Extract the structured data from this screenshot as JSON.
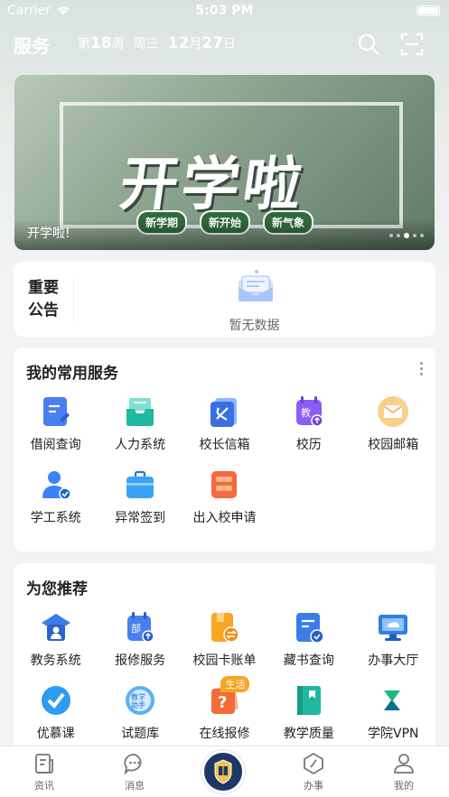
{
  "status_bar": {
    "carrier": "Carrier",
    "time": "5:03 PM"
  },
  "header": {
    "title": "服务",
    "week_prefix": "第",
    "week_num": "18",
    "week_suffix": "周",
    "weekday": "周三",
    "month": "12",
    "month_suffix": "月",
    "day": "27",
    "day_suffix": "日"
  },
  "banner": {
    "headline": "开学啦",
    "tags": [
      "新学期",
      "新开始",
      "新气象"
    ],
    "caption": "开学啦!",
    "page_count": 5,
    "active_page": 2
  },
  "notice": {
    "label": "重要公告",
    "empty_text": "暂无数据"
  },
  "services": {
    "title": "我的常用服务",
    "items": [
      {
        "label": "借阅查询",
        "icon": "borrow-icon",
        "color": "#4a7ff0"
      },
      {
        "label": "人力系统",
        "icon": "hr-inbox-icon",
        "color": "#1fb8a0"
      },
      {
        "label": "校长信箱",
        "icon": "principal-mailbox-icon",
        "color": "#3a6fe0"
      },
      {
        "label": "校历",
        "icon": "calendar-icon",
        "color": "#8b5cf6"
      },
      {
        "label": "校园邮箱",
        "icon": "email-icon",
        "color": "#f5b45a"
      },
      {
        "label": "学工系统",
        "icon": "user-check-icon",
        "color": "#3b82f6"
      },
      {
        "label": "异常签到",
        "icon": "briefcase-icon",
        "color": "#38a3f5"
      },
      {
        "label": "出入校申请",
        "icon": "gate-icon",
        "color": "#f26b3a"
      }
    ]
  },
  "recommend": {
    "title": "为您推荐",
    "items": [
      {
        "label": "教务系统",
        "icon": "academic-icon",
        "color": "#3b7de8"
      },
      {
        "label": "报修服务",
        "icon": "repair-icon",
        "color": "#4a7ff0"
      },
      {
        "label": "校园卡账单",
        "icon": "campus-card-icon",
        "color": "#f5a623"
      },
      {
        "label": "藏书查询",
        "icon": "book-search-icon",
        "color": "#3b7de8"
      },
      {
        "label": "办事大厅",
        "icon": "monitor-icon",
        "color": "#2f7fe6"
      },
      {
        "label": "优慕课",
        "icon": "course-icon",
        "color": "#2d9cf0"
      },
      {
        "label": "试题库",
        "icon": "question-bank-icon",
        "color": "#5ab0f5"
      },
      {
        "label": "在线报修",
        "icon": "online-repair-icon",
        "color": "#f26b3a",
        "badge": "生活"
      },
      {
        "label": "教学质量",
        "icon": "teaching-quality-icon",
        "color": "#1fb8a0"
      },
      {
        "label": "学院VPN",
        "icon": "vpn-icon",
        "color": "#1fb87a"
      }
    ]
  },
  "tabbar": {
    "tabs": [
      {
        "label": "资讯",
        "icon": "news-icon"
      },
      {
        "label": "消息",
        "icon": "message-icon"
      },
      {
        "label": "",
        "icon": "school-logo-icon"
      },
      {
        "label": "办事",
        "icon": "compass-icon"
      },
      {
        "label": "我的",
        "icon": "profile-icon"
      }
    ]
  }
}
